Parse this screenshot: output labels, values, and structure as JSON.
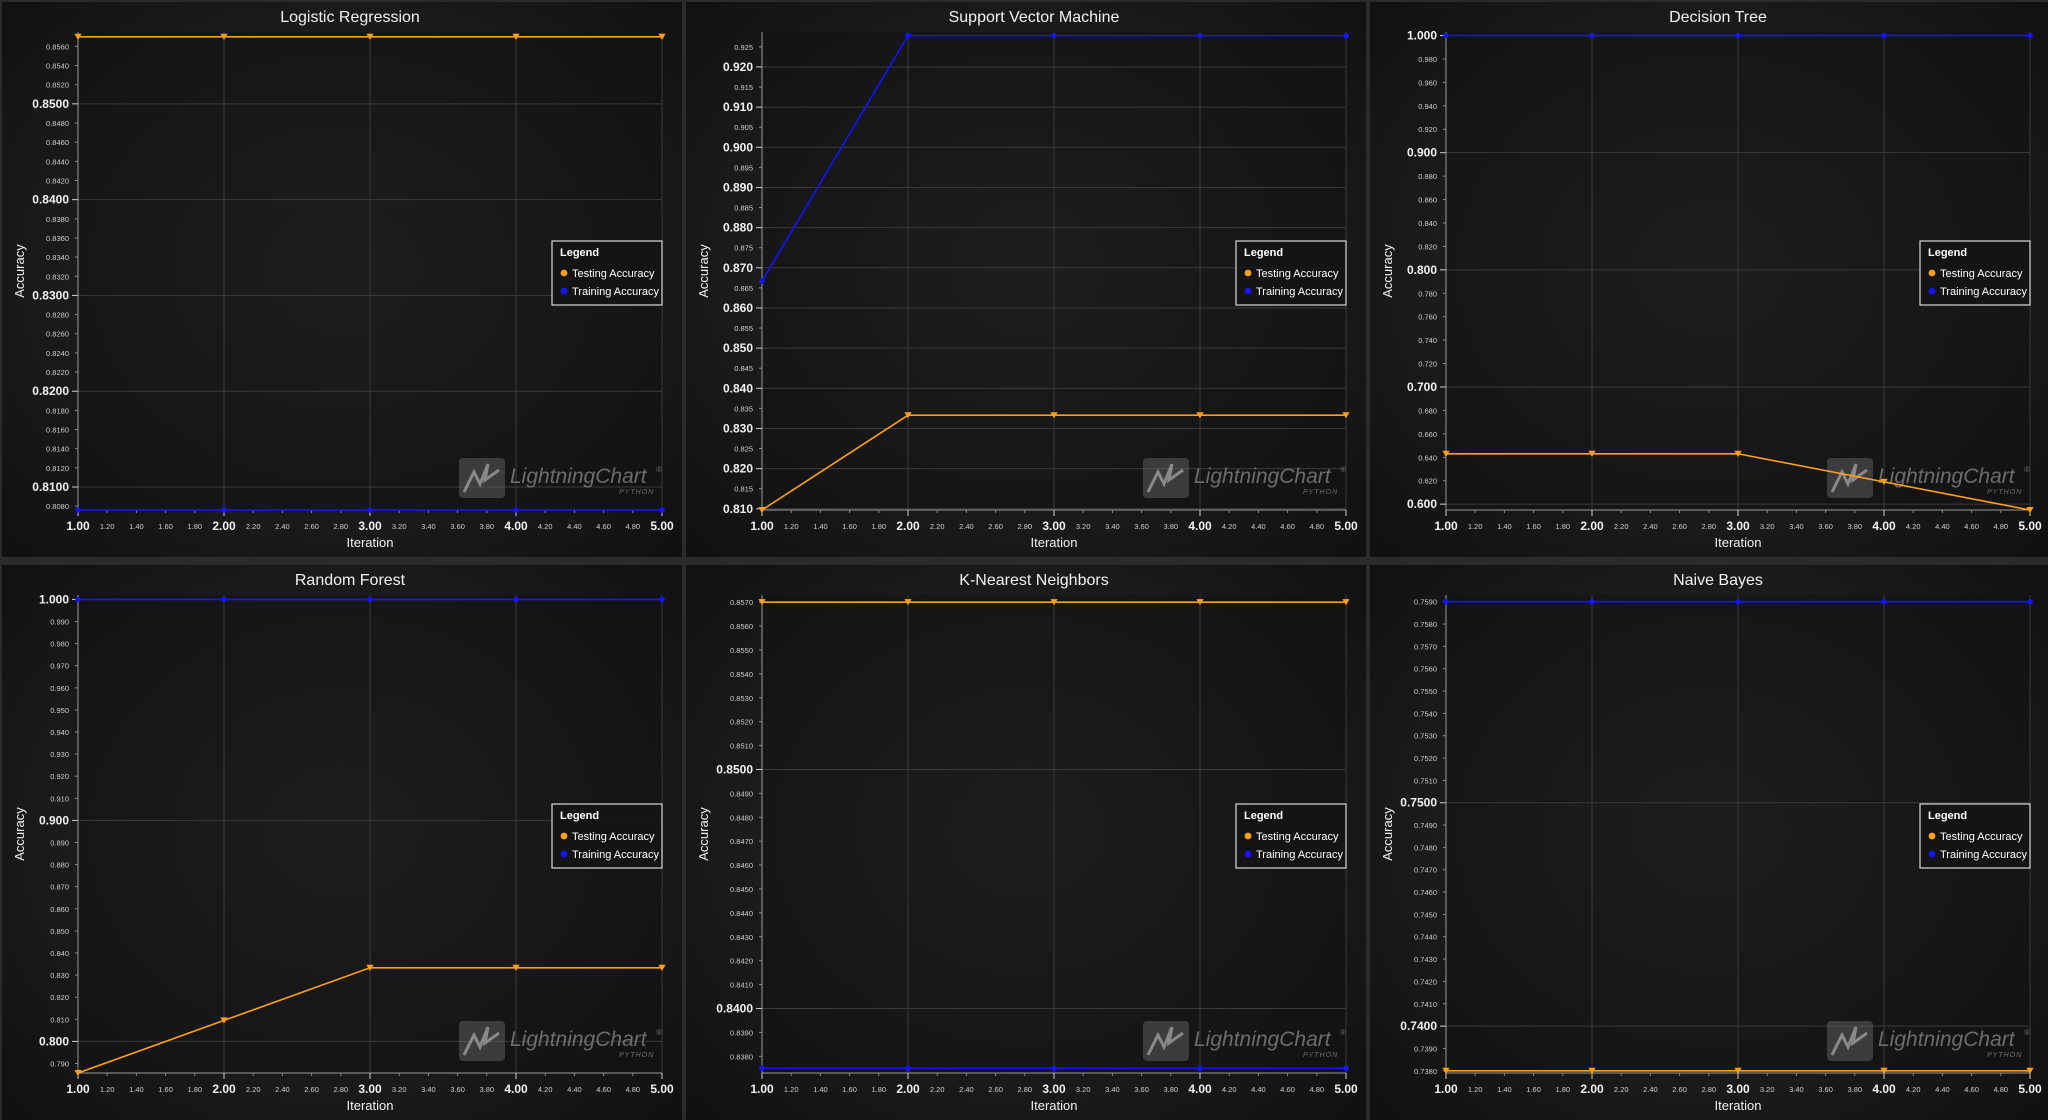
{
  "legend": {
    "title": "Legend",
    "testing_label": "Testing Accuracy",
    "training_label": "Training Accuracy"
  },
  "watermark": {
    "main": "LightningChart",
    "reg": "®",
    "sub": "PYTHON"
  },
  "colors": {
    "testing": "#ff9f1a",
    "training": "#1414ff",
    "background": "#151515",
    "grid": "#3a3a3a",
    "text": "#f2f2f2"
  },
  "chart_data": [
    {
      "type": "line",
      "title": "Logistic Regression",
      "xlabel": "Iteration",
      "ylabel": "Accuracy",
      "x": [
        1,
        2,
        3,
        4,
        5
      ],
      "xlim": [
        1,
        5
      ],
      "ylim": [
        0.8076,
        0.8575
      ],
      "y_major_ticks": [
        "0.8100",
        "0.8200",
        "0.8300",
        "0.8400",
        "0.8500"
      ],
      "y_minor_ticks": [
        "0.8080",
        "0.8120",
        "0.8140",
        "0.8160",
        "0.8180",
        "0.8220",
        "0.8240",
        "0.8260",
        "0.8280",
        "0.8320",
        "0.8340",
        "0.8360",
        "0.8380",
        "0.8420",
        "0.8440",
        "0.8460",
        "0.8480",
        "0.8520",
        "0.8540",
        "0.8560"
      ],
      "legend_position": "right",
      "series": [
        {
          "name": "Testing Accuracy",
          "values": [
            0.857,
            0.857,
            0.857,
            0.857,
            0.857
          ]
        },
        {
          "name": "Training Accuracy",
          "values": [
            0.8076,
            0.8076,
            0.8076,
            0.8076,
            0.8076
          ]
        }
      ]
    },
    {
      "type": "line",
      "title": "Support Vector Machine",
      "xlabel": "Iteration",
      "ylabel": "Accuracy",
      "x": [
        1,
        2,
        3,
        4,
        5
      ],
      "xlim": [
        1,
        5
      ],
      "ylim": [
        0.8097,
        0.9287
      ],
      "y_major_ticks": [
        "0.810",
        "0.820",
        "0.830",
        "0.840",
        "0.850",
        "0.860",
        "0.870",
        "0.880",
        "0.890",
        "0.900",
        "0.910",
        "0.920"
      ],
      "y_minor_ticks": [
        "0.815",
        "0.825",
        "0.835",
        "0.845",
        "0.855",
        "0.865",
        "0.875",
        "0.885",
        "0.895",
        "0.905",
        "0.915",
        "0.925"
      ],
      "legend_position": "right",
      "series": [
        {
          "name": "Testing Accuracy",
          "values": [
            0.8097,
            0.8333,
            0.8333,
            0.8333,
            0.8333
          ]
        },
        {
          "name": "Training Accuracy",
          "values": [
            0.8667,
            0.9278,
            0.9278,
            0.9278,
            0.9278
          ]
        }
      ]
    },
    {
      "type": "line",
      "title": "Decision Tree",
      "xlabel": "Iteration",
      "ylabel": "Accuracy",
      "x": [
        1,
        2,
        3,
        4,
        5
      ],
      "xlim": [
        1,
        5
      ],
      "ylim": [
        0.595,
        1.003
      ],
      "y_major_ticks": [
        "0.600",
        "0.700",
        "0.800",
        "0.900",
        "1.000"
      ],
      "y_minor_ticks": [
        "0.620",
        "0.640",
        "0.660",
        "0.680",
        "0.720",
        "0.740",
        "0.760",
        "0.780",
        "0.820",
        "0.840",
        "0.860",
        "0.880",
        "0.920",
        "0.940",
        "0.960",
        "0.980"
      ],
      "legend_position": "right",
      "series": [
        {
          "name": "Testing Accuracy",
          "values": [
            0.643,
            0.643,
            0.643,
            0.619,
            0.595
          ]
        },
        {
          "name": "Training Accuracy",
          "values": [
            1.0,
            1.0,
            1.0,
            1.0,
            1.0
          ]
        }
      ]
    },
    {
      "type": "line",
      "title": "Random Forest",
      "xlabel": "Iteration",
      "ylabel": "Accuracy",
      "x": [
        1,
        2,
        3,
        4,
        5
      ],
      "xlim": [
        1,
        5
      ],
      "ylim": [
        0.7857,
        1.002
      ],
      "y_major_ticks": [
        "0.800",
        "0.900",
        "1.000"
      ],
      "y_minor_ticks": [
        "0.790",
        "0.810",
        "0.820",
        "0.830",
        "0.840",
        "0.850",
        "0.860",
        "0.870",
        "0.880",
        "0.890",
        "0.910",
        "0.920",
        "0.930",
        "0.940",
        "0.950",
        "0.960",
        "0.970",
        "0.980",
        "0.990"
      ],
      "legend_position": "right",
      "series": [
        {
          "name": "Testing Accuracy",
          "values": [
            0.7857,
            0.8095,
            0.8333,
            0.8333,
            0.8333
          ]
        },
        {
          "name": "Training Accuracy",
          "values": [
            1.0,
            1.0,
            1.0,
            1.0,
            1.0
          ]
        }
      ]
    },
    {
      "type": "line",
      "title": "K-Nearest Neighbors",
      "xlabel": "Iteration",
      "ylabel": "Accuracy",
      "x": [
        1,
        2,
        3,
        4,
        5
      ],
      "xlim": [
        1,
        5
      ],
      "ylim": [
        0.8373,
        0.8573
      ],
      "y_major_ticks": [
        "0.8400",
        "0.8500"
      ],
      "y_minor_ticks": [
        "0.8380",
        "0.8390",
        "0.8410",
        "0.8420",
        "0.8430",
        "0.8440",
        "0.8450",
        "0.8460",
        "0.8470",
        "0.8480",
        "0.8490",
        "0.8510",
        "0.8520",
        "0.8530",
        "0.8540",
        "0.8550",
        "0.8560",
        "0.8570"
      ],
      "legend_position": "right",
      "series": [
        {
          "name": "Testing Accuracy",
          "values": [
            0.857,
            0.857,
            0.857,
            0.857,
            0.857
          ]
        },
        {
          "name": "Training Accuracy",
          "values": [
            0.8375,
            0.8375,
            0.8375,
            0.8375,
            0.8375
          ]
        }
      ]
    },
    {
      "type": "line",
      "title": "Naive Bayes",
      "xlabel": "Iteration",
      "ylabel": "Accuracy",
      "x": [
        1,
        2,
        3,
        4,
        5
      ],
      "xlim": [
        1,
        5
      ],
      "ylim": [
        0.7379,
        0.7593
      ],
      "y_major_ticks": [
        "0.7400",
        "0.7500"
      ],
      "y_minor_ticks": [
        "0.7380",
        "0.7390",
        "0.7410",
        "0.7420",
        "0.7430",
        "0.7440",
        "0.7450",
        "0.7460",
        "0.7470",
        "0.7480",
        "0.7490",
        "0.7510",
        "0.7520",
        "0.7530",
        "0.7540",
        "0.7550",
        "0.7560",
        "0.7570",
        "0.7580",
        "0.7590"
      ],
      "legend_position": "right",
      "series": [
        {
          "name": "Testing Accuracy",
          "values": [
            0.738,
            0.738,
            0.738,
            0.738,
            0.738
          ]
        },
        {
          "name": "Training Accuracy",
          "values": [
            0.759,
            0.759,
            0.759,
            0.759,
            0.759
          ]
        }
      ]
    }
  ]
}
